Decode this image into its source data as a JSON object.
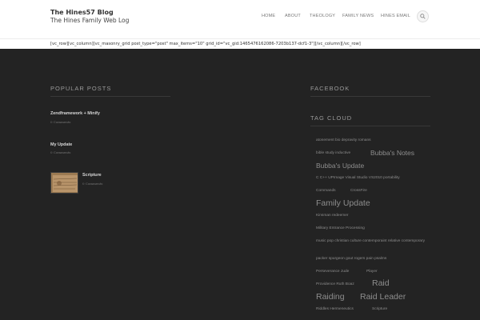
{
  "site": {
    "title": "The Hines57 Blog",
    "tagline": "The Hines Family Web Log"
  },
  "nav": {
    "items": [
      "HOME",
      "ABOUT",
      "THEOLOGY",
      "FAMILY NEWS",
      "HINES EMAIL"
    ]
  },
  "shortcode_text": "[vc_row][vc_column][vc_masonry_grid post_type=\"post\" max_items=\"10\" grid_id=\"vc_gid:1465476162086-7203b137-dcf1-3\"][/vc_column][/vc_row]",
  "popular_posts": {
    "title": "POPULAR POSTS",
    "posts": [
      {
        "title": "Zendframework + Minify",
        "comments": "0 Comments"
      },
      {
        "title": "My Update",
        "comments": "0 Comments"
      },
      {
        "title": "Scripture",
        "comments": "0 Comments"
      }
    ]
  },
  "facebook": {
    "title": "FACEBOOK"
  },
  "tag_cloud": {
    "title": "TAG CLOUD",
    "tags": [
      "atonement bio depravity romans",
      "bible study inductive",
      "Bubba's Notes",
      "Bubba's Update",
      "C C++ UPImage Visual Studio VS2010 portability",
      "Commands",
      "CrossFire",
      "Family Update",
      "Kinsman redeemer",
      "Military Entrance Processing",
      "music pop christian culture contemporaint relative contemporary",
      "packer spurgeon gout rogers pain psalms",
      "Perseverance Jude",
      "Player",
      "Providence Ruth Boaz",
      "Raid",
      "Raiding",
      "Raid Leader",
      "Riddles Hermeneutics",
      "Scripture"
    ]
  },
  "colors": {
    "dark_background": "#232323",
    "header_background": "#ffffff",
    "widget_title": "#9a9a9a",
    "tag_text": "#8d8d8d"
  }
}
